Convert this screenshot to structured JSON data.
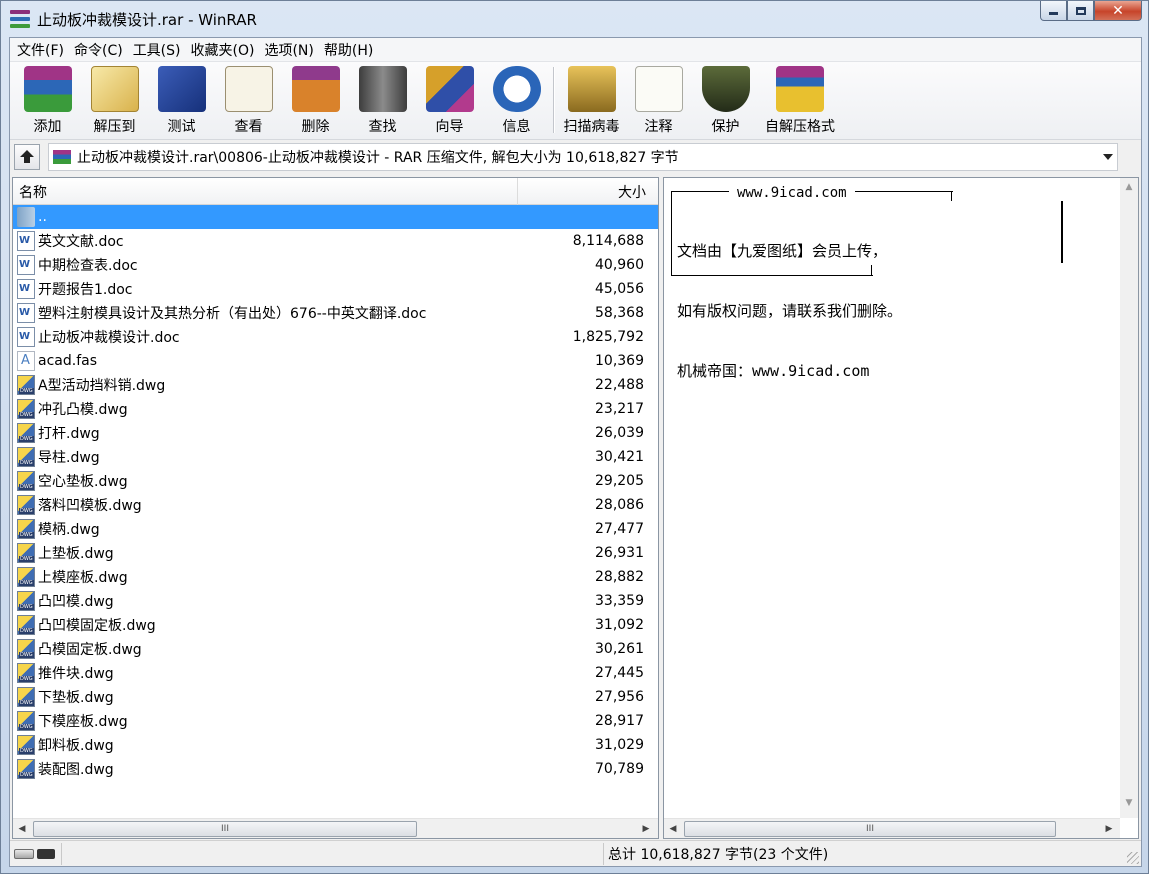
{
  "window": {
    "title": "止动板冲裁模设计.rar - WinRAR"
  },
  "menu": [
    "文件(F)",
    "命令(C)",
    "工具(S)",
    "收藏夹(O)",
    "选项(N)",
    "帮助(H)"
  ],
  "toolbar": [
    {
      "label": "添加",
      "icon": "add-icon"
    },
    {
      "label": "解压到",
      "icon": "extract-icon"
    },
    {
      "label": "测试",
      "icon": "test-icon"
    },
    {
      "label": "查看",
      "icon": "view-icon"
    },
    {
      "label": "删除",
      "icon": "delete-icon"
    },
    {
      "label": "查找",
      "icon": "find-icon"
    },
    {
      "label": "向导",
      "icon": "wizard-icon"
    },
    {
      "label": "信息",
      "icon": "info-icon"
    },
    {
      "label": "扫描病毒",
      "icon": "scan-virus-icon"
    },
    {
      "label": "注释",
      "icon": "comment-icon"
    },
    {
      "label": "保护",
      "icon": "protect-icon"
    },
    {
      "label": "自解压格式",
      "icon": "sfx-icon"
    }
  ],
  "path": {
    "text": "止动板冲裁模设计.rar\\00806-止动板冲裁模设计 - RAR 压缩文件, 解包大小为 10,618,827 字节"
  },
  "list": {
    "col_name": "名称",
    "col_size": "大小",
    "rows": [
      {
        "name": "..",
        "size": "",
        "type": "folder"
      },
      {
        "name": "英文文献.doc",
        "size": "8,114,688",
        "type": "doc"
      },
      {
        "name": "中期检查表.doc",
        "size": "40,960",
        "type": "doc"
      },
      {
        "name": "开题报告1.doc",
        "size": "45,056",
        "type": "doc"
      },
      {
        "name": "塑料注射模具设计及其热分析（有出处）676--中英文翻译.doc",
        "size": "58,368",
        "type": "doc"
      },
      {
        "name": "止动板冲裁模设计.doc",
        "size": "1,825,792",
        "type": "doc"
      },
      {
        "name": "acad.fas",
        "size": "10,369",
        "type": "fas"
      },
      {
        "name": "A型活动挡料销.dwg",
        "size": "22,488",
        "type": "dwg"
      },
      {
        "name": "冲孔凸模.dwg",
        "size": "23,217",
        "type": "dwg"
      },
      {
        "name": "打杆.dwg",
        "size": "26,039",
        "type": "dwg"
      },
      {
        "name": "导柱.dwg",
        "size": "30,421",
        "type": "dwg"
      },
      {
        "name": "空心垫板.dwg",
        "size": "29,205",
        "type": "dwg"
      },
      {
        "name": "落料凹模板.dwg",
        "size": "28,086",
        "type": "dwg"
      },
      {
        "name": "模柄.dwg",
        "size": "27,477",
        "type": "dwg"
      },
      {
        "name": "上垫板.dwg",
        "size": "26,931",
        "type": "dwg"
      },
      {
        "name": "上模座板.dwg",
        "size": "28,882",
        "type": "dwg"
      },
      {
        "name": "凸凹模.dwg",
        "size": "33,359",
        "type": "dwg"
      },
      {
        "name": "凸凹模固定板.dwg",
        "size": "31,092",
        "type": "dwg"
      },
      {
        "name": "凸模固定板.dwg",
        "size": "30,261",
        "type": "dwg"
      },
      {
        "name": "推件块.dwg",
        "size": "27,445",
        "type": "dwg"
      },
      {
        "name": "下垫板.dwg",
        "size": "27,956",
        "type": "dwg"
      },
      {
        "name": "下模座板.dwg",
        "size": "28,917",
        "type": "dwg"
      },
      {
        "name": "卸料板.dwg",
        "size": "31,029",
        "type": "dwg"
      },
      {
        "name": "装配图.dwg",
        "size": "70,789",
        "type": "dwg"
      }
    ]
  },
  "comment": {
    "title": "www.9icad.com",
    "lines": [
      "文档由【九爱图纸】会员上传，",
      "如有版权问题，请联系我们删除。",
      "机械帝国：www.9icad.com"
    ]
  },
  "scroll_thumb_glyph": "III",
  "status": {
    "text": "总计 10,618,827 字节(23 个文件)"
  },
  "colors": {
    "selection": "#3399ff",
    "close_button": "#c7442a"
  }
}
